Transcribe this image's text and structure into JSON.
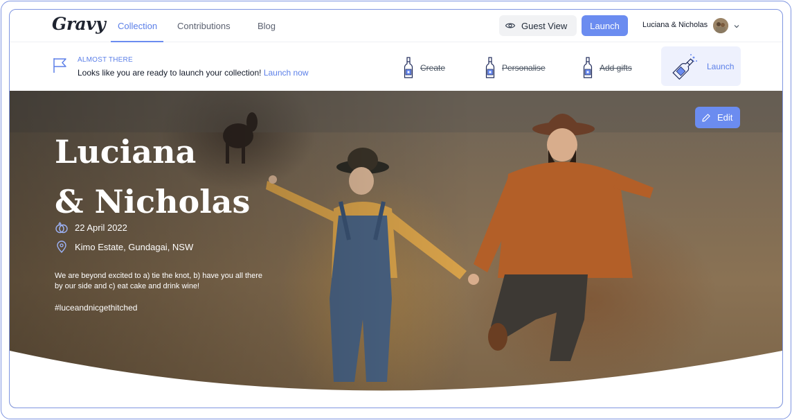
{
  "app": {
    "logo": "Gravy"
  },
  "nav": {
    "tabs": [
      {
        "label": "Collection",
        "active": true
      },
      {
        "label": "Contributions",
        "active": false
      },
      {
        "label": "Blog",
        "active": false
      }
    ],
    "guest_view_label": "Guest View",
    "launch_label": "Launch",
    "user_name": "Luciana & Nicholas"
  },
  "progress": {
    "eyebrow": "ALMOST THERE",
    "message": "Looks like you are ready to launch your collection!",
    "message_link": "Launch now",
    "steps": [
      {
        "label": "Create",
        "done": true
      },
      {
        "label": "Personalise",
        "done": true
      },
      {
        "label": "Add gifts",
        "done": true
      },
      {
        "label": "Launch",
        "done": false,
        "current": true
      }
    ]
  },
  "hero": {
    "edit_label": "Edit",
    "title_line1": "Luciana",
    "title_line2": "& Nicholas",
    "date": "22 April 2022",
    "location": "Kimo Estate, Gundagai, NSW",
    "description": "We are beyond excited to a) tie the knot, b) have you all there by our side and c) eat cake and drink wine!",
    "hashtag": "#luceandnicgethitched"
  },
  "colors": {
    "accent": "#6b8cf0",
    "accent_text": "#5b7fe8",
    "launch_step_bg": "#eef1fd",
    "frame": "#7f95e0"
  },
  "icons": {
    "guest_view": "eye-icon",
    "flag": "flag-icon",
    "step": "bottle-icon",
    "launch_step": "champagne-pop-icon",
    "edit": "pencil-icon",
    "date": "rings-icon",
    "location": "map-pin-icon",
    "user_menu": "chevron-down-icon"
  }
}
